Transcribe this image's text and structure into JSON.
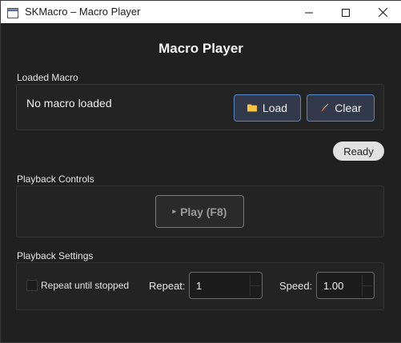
{
  "window": {
    "title": "SKMacro – Macro Player",
    "icon": "app-window-icon",
    "controls": [
      "minimize-icon",
      "maximize-icon",
      "close-icon"
    ]
  },
  "main": {
    "heading": "Macro Player"
  },
  "loaded_macro": {
    "label": "Loaded Macro",
    "status": "No macro loaded",
    "load_label": "Load",
    "load_icon": "folder-icon",
    "clear_label": "Clear",
    "clear_icon": "broom-icon"
  },
  "status_badge": "Ready",
  "playback_controls": {
    "label": "Playback Controls",
    "play_glyph": "▸",
    "play_label": "Play (F8)",
    "play_enabled": false
  },
  "playback_settings": {
    "label": "Playback Settings",
    "repeat_until_stopped_label": "Repeat until stopped",
    "repeat_until_stopped_checked": false,
    "repeat_label": "Repeat:",
    "repeat_value": "1",
    "speed_label": "Speed:",
    "speed_value": "1.00"
  },
  "colors": {
    "background": "#202020",
    "accent_border": "#5389c6",
    "folder": "#f5c542",
    "broom": "#e8672a"
  }
}
